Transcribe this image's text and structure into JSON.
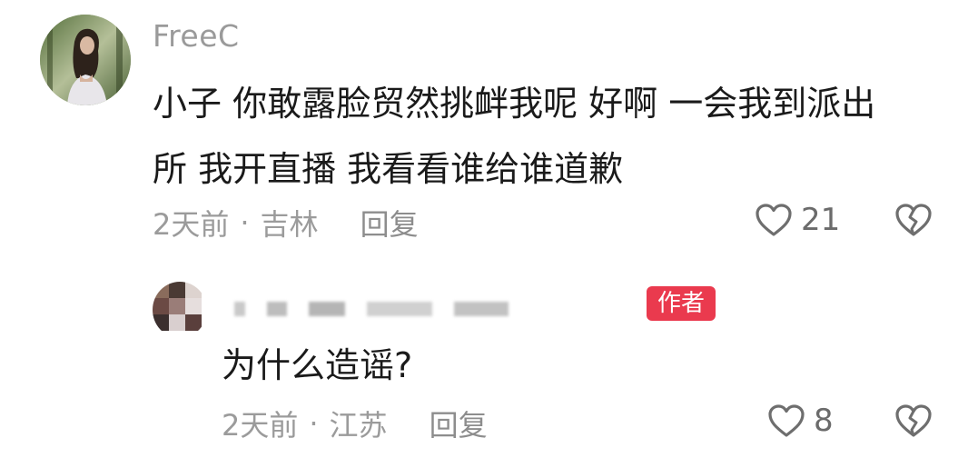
{
  "comment": {
    "username": "FreeC",
    "text_line1": "小子 你敢露脸贸然挑衅我呢 好啊 一会我到派出",
    "text_line2": "所 我开直播 我看看谁给谁道歉",
    "time": "2天前",
    "separator": "·",
    "location": "吉林",
    "reply_label": "回复",
    "likes": "21"
  },
  "reply": {
    "badge": "作者",
    "text": "为什么造谣?",
    "time": "2天前",
    "separator": "·",
    "location": "江苏",
    "reply_label": "回复",
    "likes": "8"
  },
  "icons": {
    "like": "heart-outline-icon",
    "dislike": "broken-heart-icon"
  },
  "colors": {
    "accent_badge": "#ea3a4e",
    "meta_text": "#9b9b9b",
    "username": "#9a9a9a"
  }
}
